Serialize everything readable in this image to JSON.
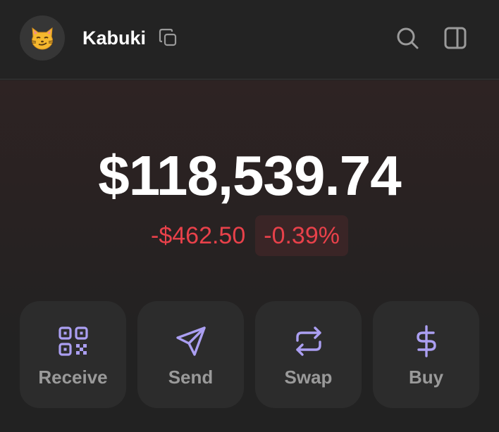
{
  "header": {
    "account_name": "Kabuki",
    "avatar_icon": "smirking-cat-emoji",
    "copy_icon": "copy-icon",
    "search_icon": "search-icon",
    "panel_icon": "sidebar-panel-icon"
  },
  "portfolio": {
    "balance": "$118,539.74",
    "change_amount": "-$462.50",
    "change_percent": "-0.39%"
  },
  "actions": [
    {
      "label": "Receive",
      "icon": "qr-code-icon"
    },
    {
      "label": "Send",
      "icon": "paper-plane-icon"
    },
    {
      "label": "Swap",
      "icon": "swap-arrows-icon"
    },
    {
      "label": "Buy",
      "icon": "dollar-icon"
    }
  ],
  "colors": {
    "negative": "#e8414a",
    "accent": "#ab9ff2",
    "background": "#222222"
  }
}
